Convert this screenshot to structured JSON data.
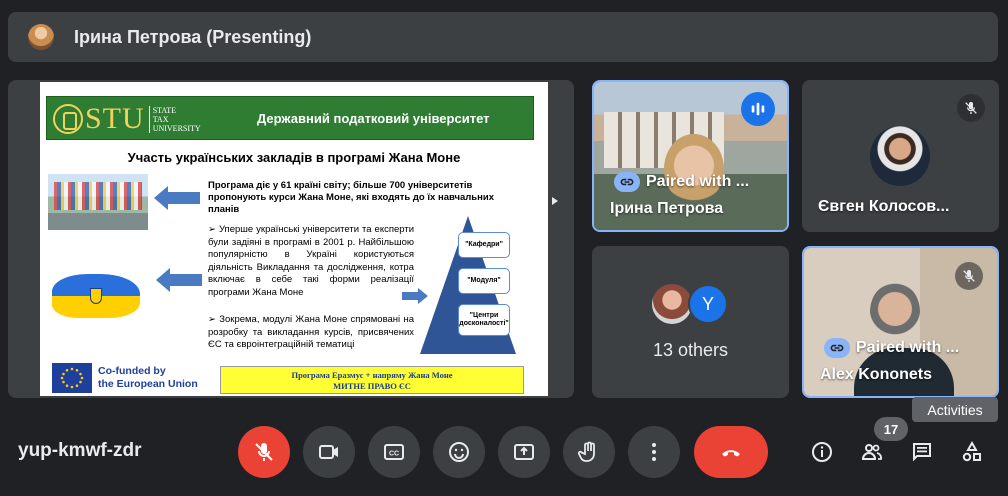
{
  "presenter": {
    "name": "Ірина Петрова (Presenting)"
  },
  "slide": {
    "logo_text": "STU",
    "logo_sub": "STATE\nTAX\nUNIVERSITY",
    "university": "Державний податковий університет",
    "title": "Участь українських закладів в програмі Жана Моне",
    "text1": "Програма діє у 61 країні світу; більше 700 університетів пропонують курси Жана Моне, які входять до їх навчальних планів",
    "text2": "➢ Уперше українські університети та експерти були задіяні в програмі в 2001 р. Найбільшою популярністю в Україні користуються діяльність Викладання та дослідження, котра включає в себе такі форми реалізації програми Жана Моне",
    "text3": "➢ Зокрема, модулі Жана Моне спрямовані на розробку та викладання курсів, присвячених ЄС та євроінтеграційній тематиці",
    "pyramid": [
      "\"Кафедри\"",
      "\"Модуля\"",
      "\"Центри досконалості\""
    ],
    "eu_text": "Co-funded by\nthe European Union",
    "yellow_bar": "Програма Еразмус + напряму Жана Моне\nМИТНЕ ПРАВО ЄС"
  },
  "participants": {
    "irina": {
      "name": "Ірина Петрова",
      "paired": "Paired with ..."
    },
    "evgen": {
      "name": "Євген Колосов..."
    },
    "others": {
      "count_label": "13 others",
      "avatar_letter": "Y"
    },
    "alex": {
      "name": "Alex Kononets",
      "paired": "Paired with ..."
    }
  },
  "tooltip": "Activities",
  "meeting_code": "yup-kmwf-zdr",
  "people_count": "17",
  "colors": {
    "accent": "#8ab4f8",
    "danger": "#ea4335",
    "surface": "#3c4043",
    "background": "#202124"
  }
}
